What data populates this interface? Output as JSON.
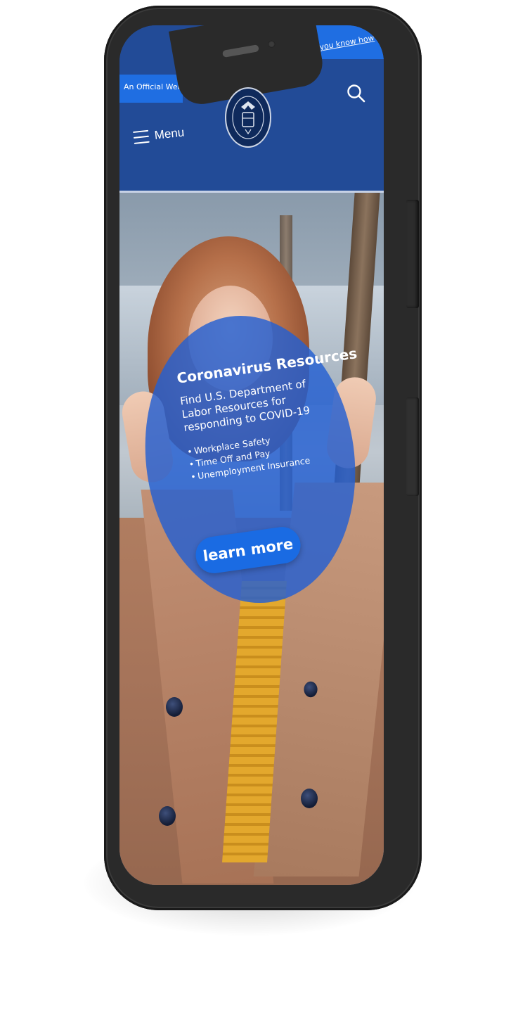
{
  "banner": {
    "official_text": "An Official Website",
    "howto_text": "you know how"
  },
  "header": {
    "menu_label": "Menu",
    "seal_text": "DEPARTMENT OF LABOR · UNITED STATES OF AMERICA"
  },
  "promo": {
    "title": "Coronavirus Resources",
    "subtitle": "Find U.S. Department of Labor Resources for responding to COVID-19",
    "items": [
      "Workplace Safety",
      "Time Off and Pay",
      "Unemployment Insurance"
    ],
    "button_label": "learn more"
  },
  "colors": {
    "header_blue": "#224b97",
    "accent_blue": "#1f6ee2",
    "promo_blue": "#235fd2",
    "phone_frame": "#2a2a2a"
  }
}
